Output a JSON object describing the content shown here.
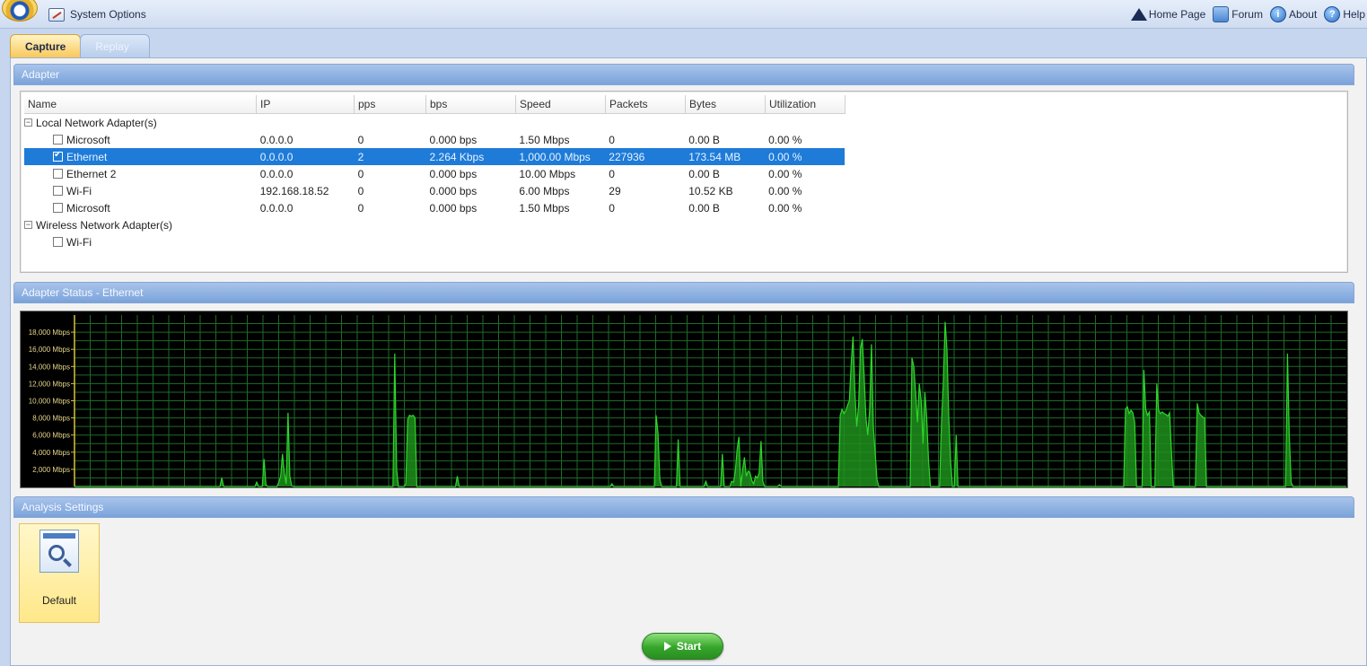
{
  "topbar": {
    "system_options": "System Options",
    "links": [
      {
        "label": "Home Page",
        "icon": "home-icon"
      },
      {
        "label": "Forum",
        "icon": "forum-icon"
      },
      {
        "label": "About",
        "icon": "about-icon"
      },
      {
        "label": "Help",
        "icon": "help-icon"
      }
    ]
  },
  "tabs": [
    {
      "label": "Capture",
      "active": true
    },
    {
      "label": "Replay",
      "active": false
    }
  ],
  "adapter_panel": {
    "title": "Adapter",
    "columns": [
      "Name",
      "IP",
      "pps",
      "bps",
      "Speed",
      "Packets",
      "Bytes",
      "Utilization"
    ],
    "groups": [
      {
        "label": "Local Network Adapter(s)",
        "rows": [
          {
            "name": "Microsoft",
            "ip": "0.0.0.0",
            "pps": "0",
            "bps": "0.000 bps",
            "speed": "1.50 Mbps",
            "packets": "0",
            "bytes": "0.00 B",
            "utilization": "0.00 %",
            "checked": false,
            "selected": false
          },
          {
            "name": "Ethernet",
            "ip": "0.0.0.0",
            "pps": "2",
            "bps": "2.264 Kbps",
            "speed": "1,000.00 Mbps",
            "packets": "227936",
            "bytes": "173.54 MB",
            "utilization": "0.00 %",
            "checked": true,
            "selected": true
          },
          {
            "name": "Ethernet 2",
            "ip": "0.0.0.0",
            "pps": "0",
            "bps": "0.000 bps",
            "speed": "10.00 Mbps",
            "packets": "0",
            "bytes": "0.00 B",
            "utilization": "0.00 %",
            "checked": false,
            "selected": false
          },
          {
            "name": "Wi-Fi",
            "ip": "192.168.18.52",
            "pps": "0",
            "bps": "0.000 bps",
            "speed": "6.00 Mbps",
            "packets": "29",
            "bytes": "10.52 KB",
            "utilization": "0.00 %",
            "checked": false,
            "selected": false
          },
          {
            "name": "Microsoft",
            "ip": "0.0.0.0",
            "pps": "0",
            "bps": "0.000 bps",
            "speed": "1.50 Mbps",
            "packets": "0",
            "bytes": "0.00 B",
            "utilization": "0.00 %",
            "checked": false,
            "selected": false
          }
        ]
      },
      {
        "label": "Wireless Network Adapter(s)",
        "rows": [
          {
            "name": "Wi-Fi",
            "checked": false,
            "selected": false
          }
        ]
      }
    ]
  },
  "status_panel": {
    "title": "Adapter Status - Ethernet"
  },
  "chart_data": {
    "type": "area",
    "title": "",
    "xlabel": "",
    "ylabel": "",
    "unit": "Mbps",
    "ylim": [
      0,
      20000
    ],
    "yticks": [
      "18,000 Mbps",
      "16,000 Mbps",
      "14,000 Mbps",
      "12,000 Mbps",
      "10,000 Mbps",
      "8,000 Mbps",
      "6,000 Mbps",
      "4,000 Mbps",
      "2,000 Mbps"
    ],
    "ytick_values": [
      18000,
      16000,
      14000,
      12000,
      10000,
      8000,
      6000,
      4000,
      2000
    ],
    "grid": true,
    "colors": {
      "line": "#2dd62a",
      "fill": "#1f8f1c",
      "grid": "#1d6b27",
      "axis": "#d8c23a"
    },
    "series": [
      {
        "values": [
          0,
          0,
          0,
          0,
          0,
          0,
          0,
          0,
          0,
          0,
          0,
          0,
          0,
          0,
          0,
          0,
          0,
          0,
          0,
          0,
          0,
          0,
          0,
          0,
          0,
          0,
          0,
          0,
          0,
          0,
          0,
          0,
          0,
          0,
          0,
          0,
          0,
          0,
          0,
          0,
          0,
          0,
          0,
          0,
          0,
          0,
          0,
          0,
          0,
          0,
          0,
          0,
          0,
          0,
          0,
          0,
          0,
          0,
          0,
          0,
          0,
          0,
          0,
          0,
          0,
          0,
          0,
          0,
          0,
          0,
          0,
          0,
          0,
          0,
          0,
          0,
          0,
          0,
          0,
          0,
          1000,
          0,
          0,
          0,
          0,
          0,
          0,
          0,
          0,
          0,
          0,
          0,
          0,
          0,
          0,
          0,
          0,
          0,
          0,
          500,
          0,
          0,
          0,
          3200,
          200,
          0,
          0,
          0,
          0,
          0,
          0,
          500,
          1200,
          3800,
          1600,
          300,
          8600,
          1200,
          100,
          0,
          0,
          0,
          0,
          0,
          0,
          0,
          0,
          0,
          0,
          0,
          0,
          0,
          0,
          0,
          0,
          0,
          0,
          0,
          0,
          0,
          0,
          0,
          0,
          0,
          0,
          0,
          0,
          0,
          0,
          0,
          0,
          0,
          0,
          0,
          0,
          0,
          0,
          0,
          0,
          0,
          0,
          0,
          0,
          0,
          0,
          0,
          0,
          0,
          0,
          0,
          0,
          0,
          0,
          0,
          15500,
          2000,
          0,
          0,
          0,
          0,
          300,
          7800,
          8300,
          8200,
          8300,
          8000,
          0,
          0,
          0,
          0,
          0,
          0,
          0,
          0,
          0,
          0,
          0,
          0,
          0,
          0,
          0,
          0,
          0,
          0,
          0,
          0,
          0,
          0,
          1200,
          0,
          0,
          0,
          0,
          0,
          0,
          0,
          0,
          0,
          0,
          0,
          0,
          0,
          0,
          0,
          0,
          0,
          0,
          0,
          0,
          0,
          0,
          0,
          0,
          0,
          0,
          0,
          0,
          0,
          0,
          0,
          0,
          0,
          0,
          0,
          0,
          0,
          0,
          0,
          0,
          0,
          0,
          0,
          0,
          0,
          0,
          0,
          0,
          0,
          0,
          0,
          0,
          0,
          0,
          0,
          0,
          0,
          0,
          0,
          0,
          0,
          0,
          0,
          0,
          0,
          0,
          0,
          0,
          0,
          0,
          0,
          0,
          0,
          0,
          0,
          0,
          0,
          0,
          0,
          0,
          0,
          0,
          0,
          300,
          0,
          0,
          0,
          0,
          0,
          0,
          0,
          0,
          0,
          0,
          0,
          0,
          0,
          0,
          0,
          0,
          0,
          0,
          0,
          0,
          0,
          0,
          0,
          8300,
          6200,
          900,
          0,
          0,
          0,
          0,
          0,
          0,
          0,
          0,
          0,
          5500,
          0,
          0,
          0,
          0,
          0,
          0,
          0,
          0,
          0,
          0,
          0,
          0,
          0,
          0,
          600,
          0,
          0,
          0,
          0,
          0,
          0,
          0,
          0,
          3800,
          0,
          0,
          0,
          0,
          600,
          500,
          1700,
          4300,
          5800,
          0,
          2000,
          3400,
          1200,
          1800,
          1600,
          700,
          300,
          1200,
          1000,
          1600,
          5300,
          600,
          0,
          0,
          0,
          0,
          0,
          0,
          0,
          0,
          200,
          0,
          0,
          0,
          0,
          0,
          0,
          0,
          0,
          0,
          0,
          0,
          0,
          0,
          0,
          0,
          0,
          0,
          0,
          0,
          0,
          0,
          0,
          0,
          0,
          0,
          0,
          0,
          0,
          0,
          0,
          0,
          0,
          8300,
          9000,
          8500,
          8800,
          9500,
          10000,
          14500,
          17500,
          11000,
          7000,
          9500,
          16000,
          17200,
          13000,
          8000,
          6000,
          9000,
          16600,
          7000,
          4000,
          800,
          0,
          0,
          0,
          0,
          0,
          0,
          0,
          0,
          0,
          0,
          0,
          0,
          0,
          0,
          0,
          0,
          0,
          0,
          15000,
          14000,
          11000,
          7500,
          12000,
          10000,
          5000,
          11000,
          8000,
          3000,
          0,
          0,
          0,
          0,
          0,
          0,
          7500,
          12000,
          19200,
          16000,
          8000,
          3000,
          0,
          0,
          6000,
          0,
          0,
          0,
          0,
          0,
          0,
          0,
          0,
          0,
          0,
          0,
          0,
          0,
          0,
          0,
          0,
          0,
          0,
          0,
          0,
          0,
          0,
          0,
          0,
          0,
          0,
          0,
          0,
          0,
          0,
          0,
          0,
          0,
          0,
          0,
          0,
          0,
          0,
          0,
          0,
          0,
          0,
          0,
          0,
          0,
          0,
          0,
          0,
          0,
          0,
          0,
          0,
          0,
          0,
          0,
          0,
          0,
          0,
          0,
          0,
          0,
          0,
          0,
          0,
          0,
          0,
          0,
          0,
          0,
          0,
          0,
          0,
          0,
          0,
          0,
          0,
          0,
          0,
          0,
          0,
          0,
          0,
          0,
          0,
          0,
          0,
          0,
          0,
          0,
          0,
          0,
          9000,
          9300,
          8500,
          8900,
          8600,
          7500,
          0,
          0,
          0,
          0,
          13600,
          9000,
          8300,
          8700,
          0,
          0,
          0,
          12000,
          8900,
          8500,
          8700,
          8500,
          8400,
          8200,
          8600,
          4000,
          0,
          0,
          0,
          0,
          0,
          0,
          0,
          0,
          0,
          0,
          0,
          0,
          0,
          9700,
          8600,
          8300,
          8100,
          8000,
          0,
          0,
          0,
          0,
          0,
          0,
          0,
          0,
          0,
          0,
          0,
          0,
          0,
          0,
          0,
          0,
          0,
          0,
          0,
          0,
          0,
          0,
          0,
          0,
          0,
          0,
          0,
          0,
          0,
          0,
          0,
          0,
          0,
          0,
          0,
          0,
          0,
          0,
          0,
          0,
          0,
          0,
          0,
          0,
          15500,
          6000,
          500,
          0,
          0,
          0,
          0,
          0,
          0,
          0,
          0,
          0,
          0,
          0,
          0,
          0,
          0,
          0,
          0,
          0,
          0,
          0,
          0,
          0,
          0,
          0,
          0,
          0,
          0,
          0,
          0,
          0,
          0
        ]
      }
    ]
  },
  "analysis_panel": {
    "title": "Analysis Settings",
    "default_label": "Default"
  },
  "start_button": {
    "label": "Start"
  }
}
